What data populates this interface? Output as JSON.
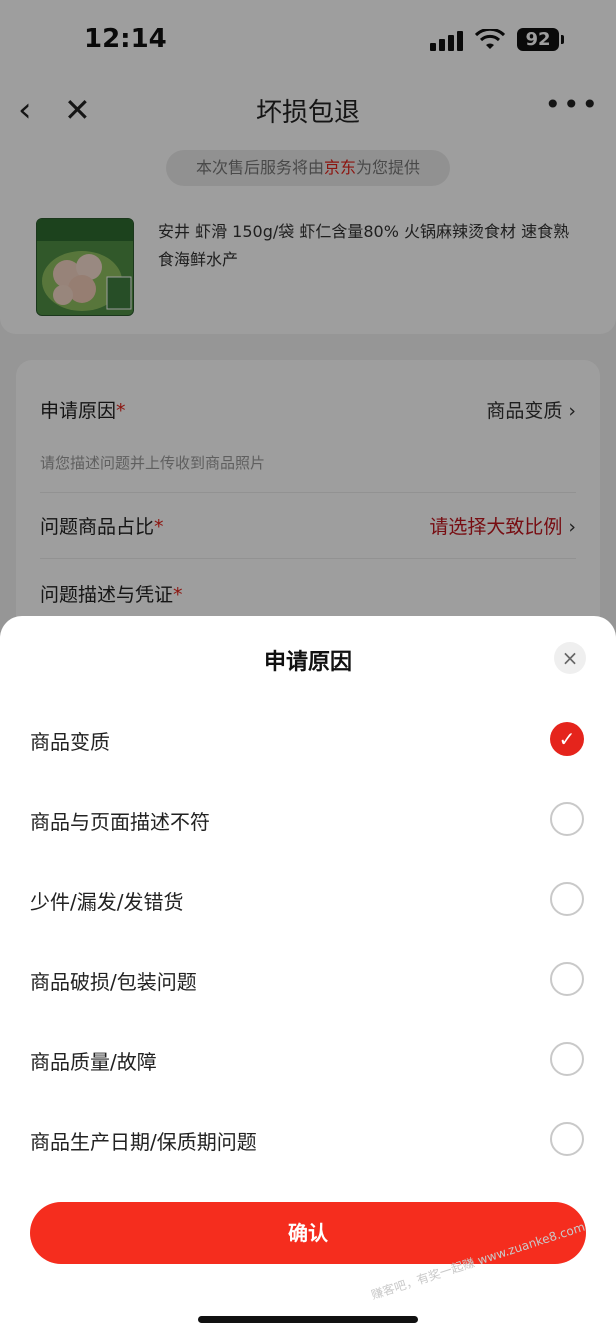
{
  "status_bar": {
    "time": "12:14",
    "battery": "92"
  },
  "nav": {
    "back_icon": "chevron-left-icon",
    "close_icon": "close-icon",
    "title": "坏损包退",
    "more_icon": "more-icon"
  },
  "service": {
    "prefix": "本次售后服务将由",
    "brand": "京东",
    "suffix": "为您提供"
  },
  "product": {
    "title": "安井 虾滑 150g/袋 虾仁含量80% 火锅麻辣烫食材 速食熟食海鲜水产"
  },
  "form": {
    "reason_label": "申请原因",
    "reason_value": "商品变质",
    "hint": "请您描述问题并上传收到商品照片",
    "ratio_label": "问题商品占比",
    "ratio_value": "请选择大致比例",
    "desc_label": "问题描述与凭证",
    "required_mark": "*",
    "chevron": "›"
  },
  "sheet": {
    "title": "申请原因",
    "close_icon": "×",
    "options": [
      {
        "label": "商品变质",
        "checked": true
      },
      {
        "label": "商品与页面描述不符",
        "checked": false
      },
      {
        "label": "少件/漏发/发错货",
        "checked": false
      },
      {
        "label": "商品破损/包装问题",
        "checked": false
      },
      {
        "label": "商品质量/故障",
        "checked": false
      },
      {
        "label": "商品生产日期/保质期问题",
        "checked": false
      }
    ],
    "confirm_label": "确认",
    "watermark": "赚客吧，有奖一起赚 www.zuanke8.com"
  },
  "colors": {
    "accent": "#f52d1e",
    "brand_red": "#e2231a"
  }
}
